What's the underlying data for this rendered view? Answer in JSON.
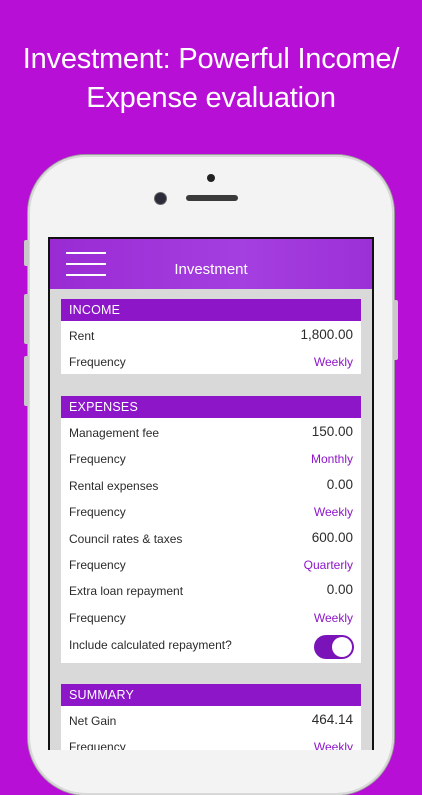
{
  "headline": {
    "line1": "Investment: Powerful Income/",
    "line2": "Expense evaluation"
  },
  "navbar": {
    "title": "Investment"
  },
  "income": {
    "header": "INCOME",
    "rows": [
      {
        "label": "Rent",
        "value": "1,800.00"
      },
      {
        "label": "Frequency",
        "value": "Weekly"
      }
    ]
  },
  "expenses": {
    "header": "EXPENSES",
    "rows": [
      {
        "label": "Management fee",
        "value": "150.00"
      },
      {
        "label": "Frequency",
        "value": "Monthly"
      },
      {
        "label": "Rental expenses",
        "value": "0.00"
      },
      {
        "label": "Frequency",
        "value": "Weekly"
      },
      {
        "label": "Council rates & taxes",
        "value": "600.00"
      },
      {
        "label": "Frequency",
        "value": "Quarterly"
      },
      {
        "label": "Extra loan repayment",
        "value": "0.00"
      },
      {
        "label": "Frequency",
        "value": "Weekly"
      }
    ],
    "toggle": {
      "label": "Include calculated repayment?",
      "on": true
    }
  },
  "summary": {
    "header": "SUMMARY",
    "rows": [
      {
        "label": "Net Gain",
        "value": "464.14"
      },
      {
        "label": "Frequency",
        "value": "Weekly"
      }
    ]
  },
  "colors": {
    "background": "#b80fd6",
    "accent": "#8d16c9",
    "toggle_on": "#7a13b8"
  }
}
